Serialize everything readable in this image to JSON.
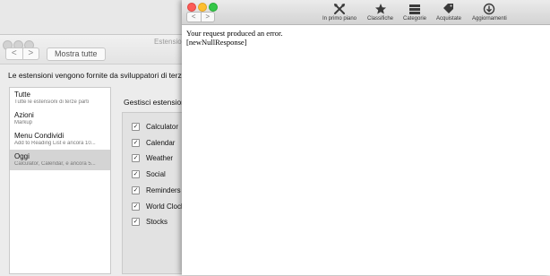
{
  "back_window": {
    "title": "Estensioni",
    "show_all_label": "Mostra tutte",
    "nav_back": "<",
    "nav_forward": ">",
    "intro_text": "Le estensioni vengono fornite da sviluppatori di terze parti pe",
    "categories": [
      {
        "title": "Tutte",
        "subtitle": "Tutte le estensioni di terze parti"
      },
      {
        "title": "Azioni",
        "subtitle": "Markup"
      },
      {
        "title": "Menu Condividi",
        "subtitle": "Add to Reading List e ancora 10..."
      },
      {
        "title": "Oggi",
        "subtitle": "Calculator, Calendar, e ancora 5..."
      }
    ],
    "manage_label": "Gestisci estensioni ne",
    "extensions": [
      {
        "label": "Calculator",
        "checked": "✓"
      },
      {
        "label": "Calendar",
        "checked": "✓"
      },
      {
        "label": "Weather",
        "checked": "✓"
      },
      {
        "label": "Social",
        "checked": "✓"
      },
      {
        "label": "Reminders",
        "checked": "✓"
      },
      {
        "label": "World Clock",
        "checked": "✓"
      },
      {
        "label": "Stocks",
        "checked": "✓"
      }
    ]
  },
  "app_store": {
    "nav_back": "<",
    "nav_forward": ">",
    "toolbar": [
      {
        "label": "In primo piano",
        "icon": "featured-icon"
      },
      {
        "label": "Classifiche",
        "icon": "star-icon"
      },
      {
        "label": "Categorie",
        "icon": "categories-icon"
      },
      {
        "label": "Acquistate",
        "icon": "tag-icon"
      },
      {
        "label": "Aggiornamenti",
        "icon": "updates-icon"
      }
    ],
    "error_line1": "Your request produced an error.",
    "error_line2": "[newNullResponse]"
  }
}
